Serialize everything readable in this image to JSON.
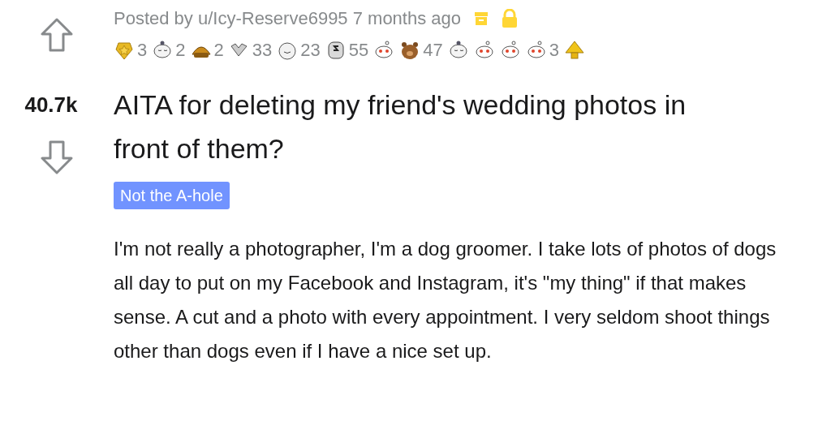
{
  "post": {
    "posted_by": "Posted by u/Icy-Reserve6995 7 months ago",
    "archived": true,
    "locked": true,
    "awards": [
      {
        "kind": "medal",
        "count": "3"
      },
      {
        "kind": "sleepy",
        "count": "2"
      },
      {
        "kind": "taco",
        "count": "2"
      },
      {
        "kind": "hands",
        "count": "33"
      },
      {
        "kind": "face",
        "count": "23"
      },
      {
        "kind": "coin",
        "count": "55"
      },
      {
        "kind": "snoo"
      },
      {
        "kind": "bear",
        "count": "47"
      },
      {
        "kind": "sleepy"
      },
      {
        "kind": "snoo"
      },
      {
        "kind": "snoo"
      },
      {
        "kind": "snoo",
        "count": "3"
      },
      {
        "kind": "pyramid"
      }
    ],
    "score": "40.7k",
    "title": "AITA for deleting my friend's wedding photos in front of them?",
    "flair": "Not the A-hole",
    "body": "I'm not really a photographer, I'm a dog groomer. I take lots of photos of dogs all day to put on my Facebook and Instagram, it's \"my thing\" if that makes sense. A cut and a photo with every appointment. I very seldom shoot things other than dogs even if I have a nice set up."
  }
}
